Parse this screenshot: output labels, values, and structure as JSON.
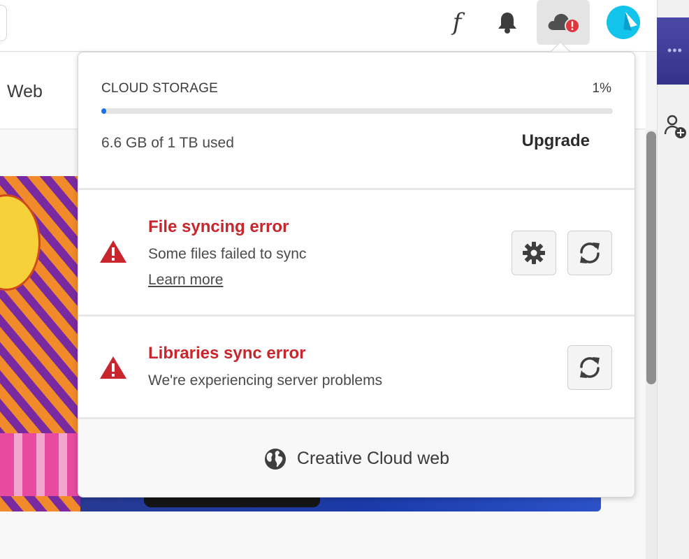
{
  "header": {
    "font_icon_glyph": "f",
    "icons": [
      "fonts-icon",
      "bell-icon",
      "cloud-error-icon",
      "avatar"
    ]
  },
  "page": {
    "nav_label": "Web"
  },
  "popover": {
    "storage": {
      "title": "CLOUD STORAGE",
      "percent_text": "1%",
      "percent_value": 0.01,
      "used_text": "6.6 GB of 1 TB used",
      "upgrade_label": "Upgrade"
    },
    "errors": [
      {
        "title": "File syncing error",
        "description": "Some files failed to sync",
        "link": "Learn more"
      },
      {
        "title": "Libraries sync error",
        "description": "We're experiencing server problems"
      }
    ],
    "footer_label": "Creative Cloud web"
  },
  "colors": {
    "error": "#c9252c",
    "progress": "#1473e6",
    "avatar": "#12c3ec"
  }
}
